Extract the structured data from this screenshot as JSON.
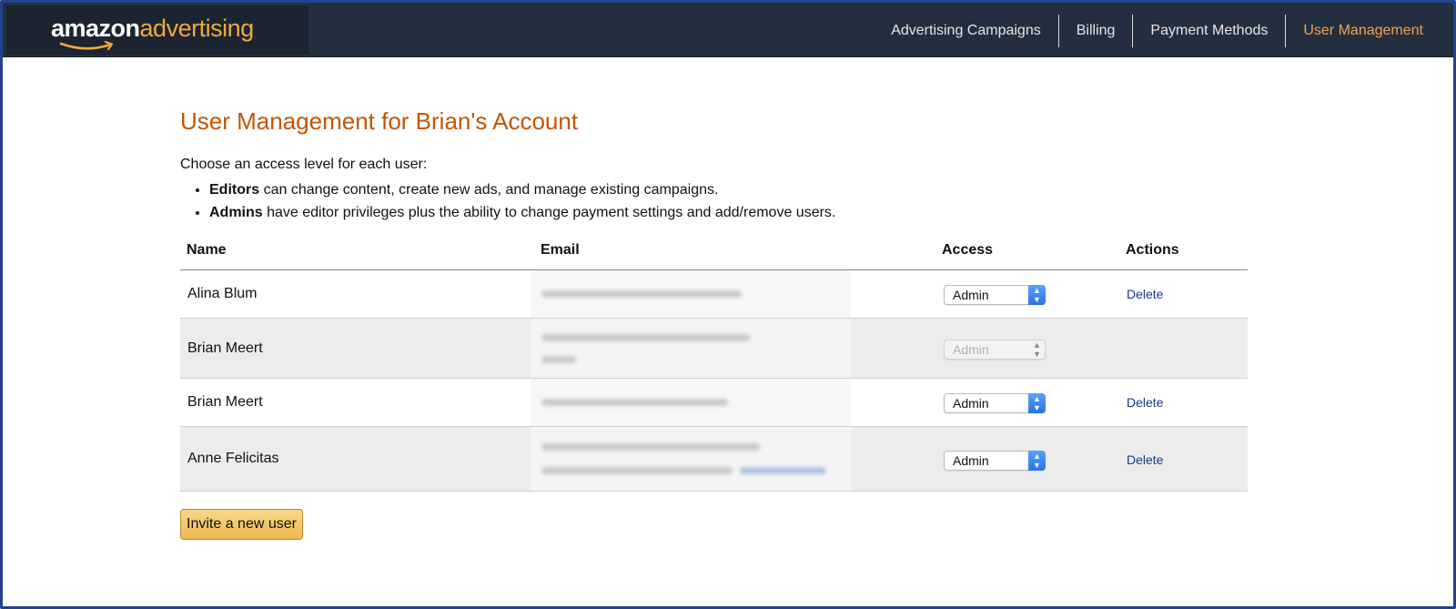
{
  "brand": {
    "logo_part1": "amazon",
    "logo_part2": "advertising",
    "accent_color": "#f0a93b",
    "header_bg": "#232f3e"
  },
  "nav": {
    "items": [
      {
        "label": "Advertising Campaigns",
        "active": false
      },
      {
        "label": "Billing",
        "active": false
      },
      {
        "label": "Payment Methods",
        "active": false
      },
      {
        "label": "User Management",
        "active": true
      }
    ]
  },
  "page": {
    "title": "User Management for Brian's Account",
    "intro": "Choose an access level for each user:",
    "bullets": [
      {
        "term": "Editors",
        "text": " can change content, create new ads, and manage existing campaigns."
      },
      {
        "term": "Admins",
        "text": " have editor privileges plus the ability to change payment settings and add/remove users."
      }
    ],
    "title_color": "#c45500"
  },
  "table": {
    "headers": {
      "name": "Name",
      "email": "Email",
      "access": "Access",
      "actions": "Actions"
    },
    "rows": [
      {
        "name": "Alina Blum",
        "access": "Admin",
        "access_enabled": true,
        "action": "Delete"
      },
      {
        "name": "Brian Meert",
        "access": "Admin",
        "access_enabled": false,
        "action": ""
      },
      {
        "name": "Brian Meert",
        "access": "Admin",
        "access_enabled": true,
        "action": "Delete"
      },
      {
        "name": "Anne Felicitas",
        "access": "Admin",
        "access_enabled": true,
        "action": "Delete"
      }
    ]
  },
  "invite_button": {
    "label": "Invite a new user"
  },
  "icons": {
    "select_arrow": "chevron-up-down-icon",
    "logo_smile": "amazon-smile-icon"
  }
}
